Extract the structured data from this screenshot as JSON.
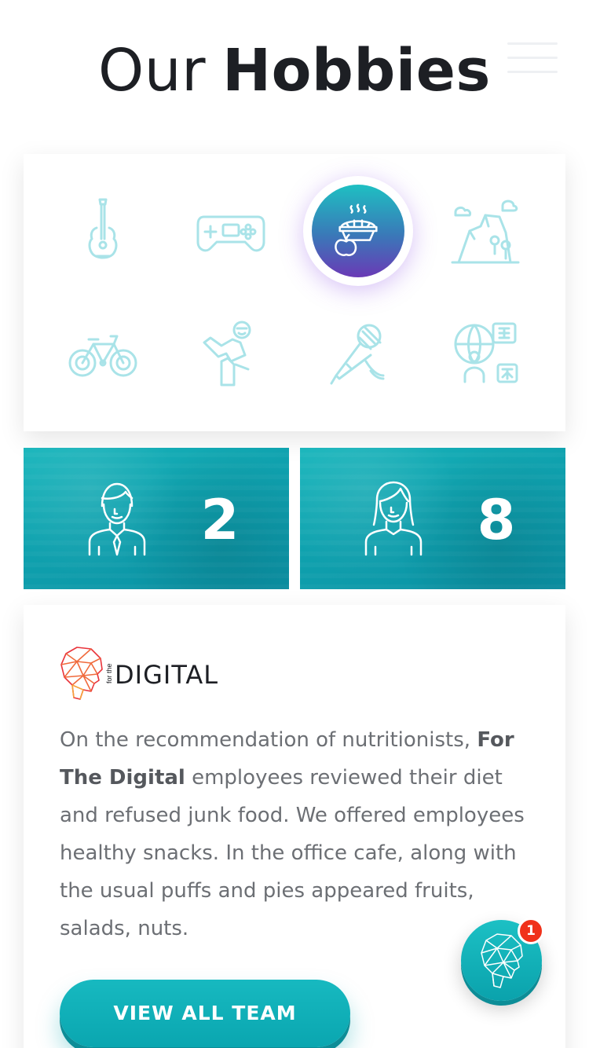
{
  "header": {
    "title_light": "Our",
    "title_bold": "Hobbies"
  },
  "hobbies": [
    {
      "name": "guitar-icon",
      "active": false
    },
    {
      "name": "gamepad-icon",
      "active": false
    },
    {
      "name": "pie-icon",
      "active": true
    },
    {
      "name": "hiking-icon",
      "active": false
    },
    {
      "name": "bicycle-icon",
      "active": false
    },
    {
      "name": "karate-icon",
      "active": false
    },
    {
      "name": "microphone-icon",
      "active": false
    },
    {
      "name": "languages-icon",
      "active": false
    }
  ],
  "stats": [
    {
      "icon": "man-icon",
      "count": "2"
    },
    {
      "icon": "woman-icon",
      "count": "8"
    }
  ],
  "company": {
    "logo_small": "for the",
    "logo_text": "DIGITAL"
  },
  "description": {
    "line1": "On the recommendation of nutritionists,",
    "company_bold": "For The Digital",
    "rest": " employees reviewed their diet and refused junk food. We offered employees healthy snacks. In the office cafe, along with the usual puffs and pies appeared fruits, salads, nuts."
  },
  "buttons": {
    "view_all": "VIEW ALL TEAM"
  },
  "chat": {
    "badge_count": "1"
  },
  "colors": {
    "accent": "#0fa9b3",
    "icon_outline": "#a9e3e8",
    "badge": "#f0311a"
  }
}
